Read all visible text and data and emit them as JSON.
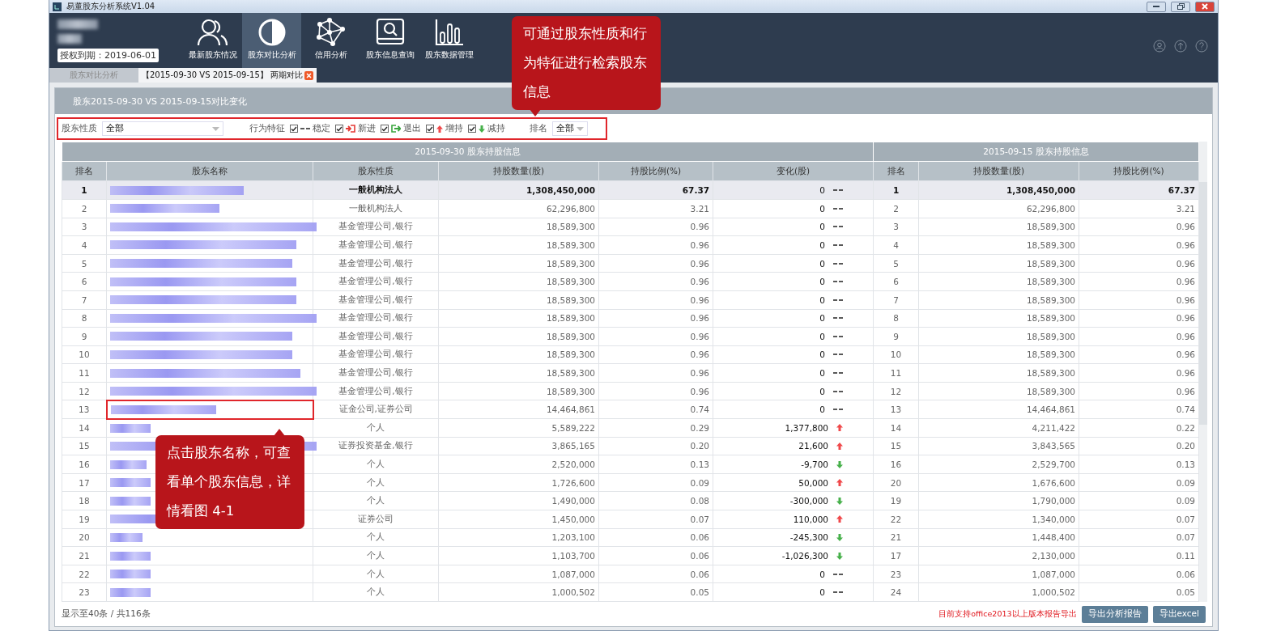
{
  "window": {
    "title": "易董股东分析系统V1.04"
  },
  "header": {
    "license": "授权到期：2019-06-01",
    "nav": [
      {
        "label": "最新股东情况",
        "kind": "people",
        "selected": false
      },
      {
        "label": "股东对比分析",
        "kind": "contrast",
        "selected": true
      },
      {
        "label": "信用分析",
        "kind": "network",
        "selected": false
      },
      {
        "label": "股东信息查询",
        "kind": "search",
        "selected": false
      },
      {
        "label": "股东数据管理",
        "kind": "bars",
        "selected": false
      }
    ]
  },
  "tabs": [
    {
      "label": "股东对比分析",
      "selected": false,
      "closable": false
    },
    {
      "label": "【2015-09-30 VS 2015-09-15】 两期对比",
      "selected": true,
      "closable": true
    }
  ],
  "panel": {
    "title": "股东2015-09-30  VS  2015-09-15对比变化"
  },
  "filters": {
    "nature_label": "股东性质",
    "nature_value": "全部",
    "behavior_label": "行为特征",
    "behaviors": [
      {
        "label": "稳定",
        "kind": "flat",
        "checked": true
      },
      {
        "label": "新进",
        "kind": "enter",
        "checked": true
      },
      {
        "label": "退出",
        "kind": "exit",
        "checked": true
      },
      {
        "label": "增持",
        "kind": "up",
        "checked": true
      },
      {
        "label": "减持",
        "kind": "down",
        "checked": true
      }
    ],
    "rank_label": "排名",
    "rank_value": "全部"
  },
  "table": {
    "group_left": "2015-09-30  股东持股信息",
    "group_right": "2015-09-15  股东持股信息",
    "columns": [
      "排名",
      "股东名称",
      "股东性质",
      "持股数量(股)",
      "持股比例(%)",
      "变化(股)",
      "排名",
      "持股数量(股)",
      "持股比例(%)"
    ],
    "rows": [
      {
        "rank": "1",
        "nature": "一般机构法人",
        "shares": "1,308,450,000",
        "ratio": "67.37",
        "change": "0",
        "kind": "flat",
        "rank2": "1",
        "shares2": "1,308,450,000",
        "ratio2": "67.37",
        "selected": true,
        "outlined": false
      },
      {
        "rank": "2",
        "nature": "一般机构法人",
        "shares": "62,296,800",
        "ratio": "3.21",
        "change": "0",
        "kind": "flat",
        "rank2": "2",
        "shares2": "62,296,800",
        "ratio2": "3.21",
        "selected": false,
        "outlined": false
      },
      {
        "rank": "3",
        "nature": "基金管理公司,银行",
        "shares": "18,589,300",
        "ratio": "0.96",
        "change": "0",
        "kind": "flat",
        "rank2": "3",
        "shares2": "18,589,300",
        "ratio2": "0.96",
        "selected": false,
        "outlined": false
      },
      {
        "rank": "4",
        "nature": "基金管理公司,银行",
        "shares": "18,589,300",
        "ratio": "0.96",
        "change": "0",
        "kind": "flat",
        "rank2": "4",
        "shares2": "18,589,300",
        "ratio2": "0.96",
        "selected": false,
        "outlined": false
      },
      {
        "rank": "5",
        "nature": "基金管理公司,银行",
        "shares": "18,589,300",
        "ratio": "0.96",
        "change": "0",
        "kind": "flat",
        "rank2": "5",
        "shares2": "18,589,300",
        "ratio2": "0.96",
        "selected": false,
        "outlined": false
      },
      {
        "rank": "6",
        "nature": "基金管理公司,银行",
        "shares": "18,589,300",
        "ratio": "0.96",
        "change": "0",
        "kind": "flat",
        "rank2": "6",
        "shares2": "18,589,300",
        "ratio2": "0.96",
        "selected": false,
        "outlined": false
      },
      {
        "rank": "7",
        "nature": "基金管理公司,银行",
        "shares": "18,589,300",
        "ratio": "0.96",
        "change": "0",
        "kind": "flat",
        "rank2": "7",
        "shares2": "18,589,300",
        "ratio2": "0.96",
        "selected": false,
        "outlined": false
      },
      {
        "rank": "8",
        "nature": "基金管理公司,银行",
        "shares": "18,589,300",
        "ratio": "0.96",
        "change": "0",
        "kind": "flat",
        "rank2": "8",
        "shares2": "18,589,300",
        "ratio2": "0.96",
        "selected": false,
        "outlined": false
      },
      {
        "rank": "9",
        "nature": "基金管理公司,银行",
        "shares": "18,589,300",
        "ratio": "0.96",
        "change": "0",
        "kind": "flat",
        "rank2": "9",
        "shares2": "18,589,300",
        "ratio2": "0.96",
        "selected": false,
        "outlined": false
      },
      {
        "rank": "10",
        "nature": "基金管理公司,银行",
        "shares": "18,589,300",
        "ratio": "0.96",
        "change": "0",
        "kind": "flat",
        "rank2": "10",
        "shares2": "18,589,300",
        "ratio2": "0.96",
        "selected": false,
        "outlined": false
      },
      {
        "rank": "11",
        "nature": "基金管理公司,银行",
        "shares": "18,589,300",
        "ratio": "0.96",
        "change": "0",
        "kind": "flat",
        "rank2": "11",
        "shares2": "18,589,300",
        "ratio2": "0.96",
        "selected": false,
        "outlined": false
      },
      {
        "rank": "12",
        "nature": "基金管理公司,银行",
        "shares": "18,589,300",
        "ratio": "0.96",
        "change": "0",
        "kind": "flat",
        "rank2": "12",
        "shares2": "18,589,300",
        "ratio2": "0.96",
        "selected": false,
        "outlined": false
      },
      {
        "rank": "13",
        "nature": "证金公司,证券公司",
        "shares": "14,464,861",
        "ratio": "0.74",
        "change": "0",
        "kind": "flat",
        "rank2": "13",
        "shares2": "14,464,861",
        "ratio2": "0.74",
        "selected": false,
        "outlined": true
      },
      {
        "rank": "14",
        "nature": "个人",
        "shares": "5,589,222",
        "ratio": "0.29",
        "change": "1,377,800",
        "kind": "up",
        "rank2": "14",
        "shares2": "4,211,422",
        "ratio2": "0.22",
        "selected": false,
        "outlined": false
      },
      {
        "rank": "15",
        "nature": "证券投资基金,银行",
        "shares": "3,865,165",
        "ratio": "0.20",
        "change": "21,600",
        "kind": "up",
        "rank2": "15",
        "shares2": "3,843,565",
        "ratio2": "0.20",
        "selected": false,
        "outlined": false
      },
      {
        "rank": "16",
        "nature": "个人",
        "shares": "2,520,000",
        "ratio": "0.13",
        "change": "-9,700",
        "kind": "down",
        "rank2": "16",
        "shares2": "2,529,700",
        "ratio2": "0.13",
        "selected": false,
        "outlined": false
      },
      {
        "rank": "17",
        "nature": "个人",
        "shares": "1,726,600",
        "ratio": "0.09",
        "change": "50,000",
        "kind": "up",
        "rank2": "20",
        "shares2": "1,676,600",
        "ratio2": "0.09",
        "selected": false,
        "outlined": false
      },
      {
        "rank": "18",
        "nature": "个人",
        "shares": "1,490,000",
        "ratio": "0.08",
        "change": "-300,000",
        "kind": "down",
        "rank2": "19",
        "shares2": "1,790,000",
        "ratio2": "0.09",
        "selected": false,
        "outlined": false
      },
      {
        "rank": "19",
        "nature": "证券公司",
        "shares": "1,450,000",
        "ratio": "0.07",
        "change": "110,000",
        "kind": "up",
        "rank2": "22",
        "shares2": "1,340,000",
        "ratio2": "0.07",
        "selected": false,
        "outlined": false
      },
      {
        "rank": "20",
        "nature": "个人",
        "shares": "1,203,100",
        "ratio": "0.06",
        "change": "-245,300",
        "kind": "down",
        "rank2": "21",
        "shares2": "1,448,400",
        "ratio2": "0.07",
        "selected": false,
        "outlined": false
      },
      {
        "rank": "21",
        "nature": "个人",
        "shares": "1,103,700",
        "ratio": "0.06",
        "change": "-1,026,300",
        "kind": "down",
        "rank2": "17",
        "shares2": "2,130,000",
        "ratio2": "0.11",
        "selected": false,
        "outlined": false
      },
      {
        "rank": "22",
        "nature": "个人",
        "shares": "1,087,000",
        "ratio": "0.06",
        "change": "0",
        "kind": "flat",
        "rank2": "23",
        "shares2": "1,087,000",
        "ratio2": "0.06",
        "selected": false,
        "outlined": false
      },
      {
        "rank": "23",
        "nature": "个人",
        "shares": "1,000,502",
        "ratio": "0.05",
        "change": "0",
        "kind": "flat",
        "rank2": "24",
        "shares2": "1,000,502",
        "ratio2": "0.05",
        "selected": false,
        "outlined": false
      }
    ]
  },
  "footer": {
    "count": "显示至40条 / 共116条",
    "note": "目前支持office2013以上版本报告导出",
    "buttons": [
      "导出分析报告",
      "导出excel"
    ]
  },
  "callouts": [
    {
      "text": "可通过股东性质和行为特征进行检索股东信息",
      "kind": "down"
    },
    {
      "text": "点击股东名称，可查看单个股东信息，详情看图 4-1",
      "kind": "up"
    }
  ]
}
